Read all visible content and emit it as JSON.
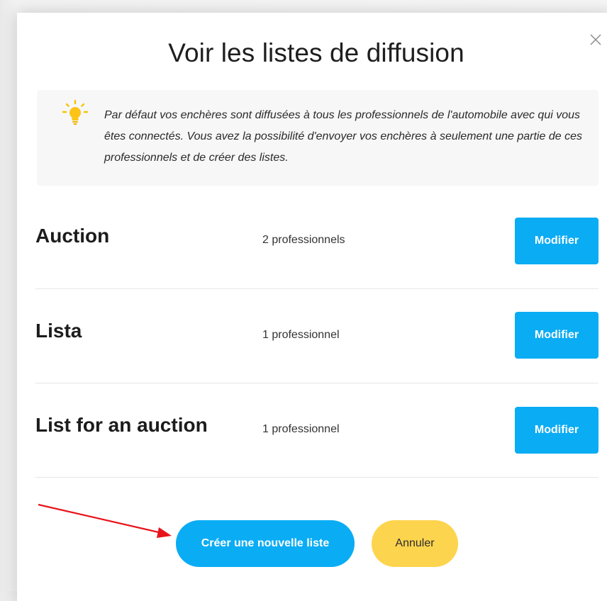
{
  "dialog": {
    "title": "Voir les listes de diffusion",
    "info_text": "Par défaut vos enchères sont diffusées à tous les professionnels de l'automobile avec qui vous êtes connectés. Vous avez la possibilité d'envoyer vos enchères à seulement une partie de ces professionnels et de créer des listes.",
    "info_icon": "lightbulb-icon",
    "close_icon": "close-icon"
  },
  "lists": [
    {
      "name": "Auction",
      "count": "2 professionnels",
      "button_label": "Modifier"
    },
    {
      "name": "Lista",
      "count": "1 professionnel",
      "button_label": "Modifier"
    },
    {
      "name": "List for an auction",
      "count": "1 professionnel",
      "button_label": "Modifier"
    }
  ],
  "actions": {
    "create_label": "Créer une nouvelle liste",
    "cancel_label": "Annuler"
  },
  "colors": {
    "primary": "#0aacf4",
    "secondary": "#fdd44e",
    "annotation_arrow": "#e8141c"
  }
}
